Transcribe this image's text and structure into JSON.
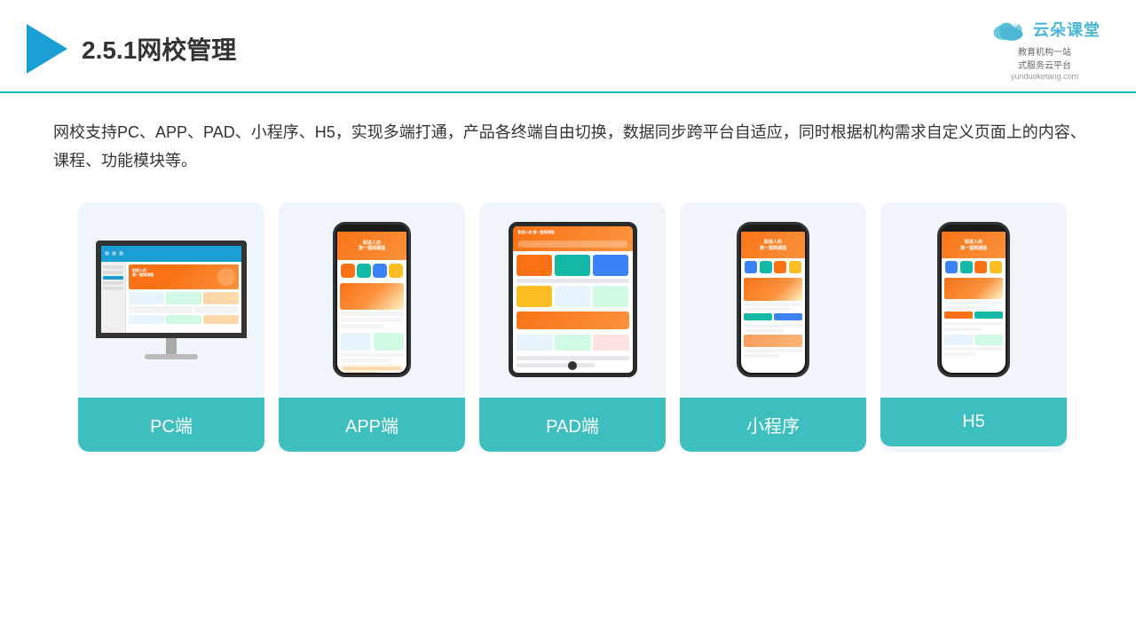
{
  "header": {
    "page_number": "2.5.1",
    "page_title": "网校管理",
    "brand_name": "云朵课堂",
    "brand_url": "yunduoketang.com",
    "brand_tagline_line1": "教育机构一站",
    "brand_tagline_line2": "式服务云平台"
  },
  "description": {
    "text": "网校支持PC、APP、PAD、小程序、H5，实现多端打通，产品各终端自由切换，数据同步跨平台自适应，同时根据机构需求自定义页面上的内容、课程、功能模块等。"
  },
  "cards": [
    {
      "id": "pc",
      "label": "PC端"
    },
    {
      "id": "app",
      "label": "APP端"
    },
    {
      "id": "pad",
      "label": "PAD端"
    },
    {
      "id": "miniprogram",
      "label": "小程序"
    },
    {
      "id": "h5",
      "label": "H5"
    }
  ],
  "colors": {
    "teal": "#3dbfbf",
    "accent_blue": "#1a9fd4",
    "border_blue": "#00b8c8",
    "card_bg": "#eef2f8",
    "orange": "#f97316"
  }
}
